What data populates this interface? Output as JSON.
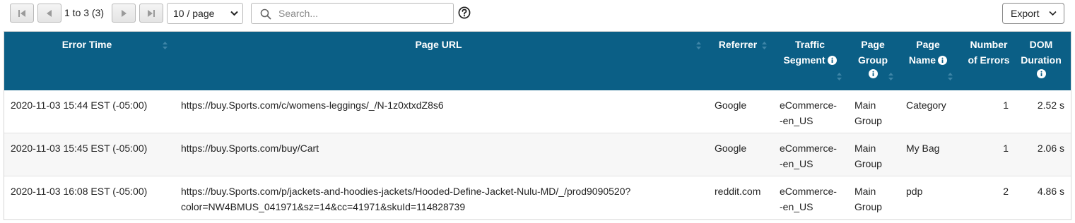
{
  "pager": {
    "range_text": "1 to 3 (3)",
    "page_size": "10 / page",
    "page_size_options": [
      "10 / page"
    ]
  },
  "search": {
    "placeholder": "Search...",
    "value": ""
  },
  "export": {
    "label": "Export"
  },
  "colors": {
    "header_bg": "#0b5f86",
    "header_text": "#ffffff",
    "row_alt": "#f7f7f7"
  },
  "columns": [
    {
      "key": "error_time",
      "label": "Error Time",
      "info": false
    },
    {
      "key": "page_url",
      "label": "Page URL",
      "info": false
    },
    {
      "key": "referrer",
      "label": "Referrer",
      "info": false
    },
    {
      "key": "traffic_segment",
      "label": "Traffic Segment",
      "info": true
    },
    {
      "key": "page_group",
      "label": "Page Group",
      "info": true
    },
    {
      "key": "page_name",
      "label": "Page Name",
      "info": true
    },
    {
      "key": "num_errors",
      "label": "Number of Errors",
      "info": false
    },
    {
      "key": "dom_duration",
      "label": "DOM Duration",
      "info": true
    }
  ],
  "rows": [
    {
      "error_time": "2020-11-03 15:44 EST (-05:00)",
      "page_url": "https://buy.Sports.com/c/womens-leggings/_/N-1z0xtxdZ8s6",
      "page_url_cont": "",
      "referrer": "Google",
      "traffic_segment_1": "eCommerce-",
      "traffic_segment_2": "-en_US",
      "page_group_1": "Main",
      "page_group_2": "Group",
      "page_name": "Category",
      "num_errors": "1",
      "dom_duration": "2.52 s"
    },
    {
      "error_time": "2020-11-03 15:45 EST (-05:00)",
      "page_url": "https://buy.Sports.com/buy/Cart",
      "page_url_cont": "",
      "referrer": "Google",
      "traffic_segment_1": "eCommerce-",
      "traffic_segment_2": "-en_US",
      "page_group_1": "Main",
      "page_group_2": "Group",
      "page_name": "My Bag",
      "num_errors": "1",
      "dom_duration": "2.06 s"
    },
    {
      "error_time": "2020-11-03 16:08 EST (-05:00)",
      "page_url": "https://buy.Sports.com/p/jackets-and-hoodies-jackets/Hooded-Define-Jacket-Nulu-MD/_/prod9090520?",
      "page_url_cont": "color=NW4BMUS_041971&sz=14&cc=41971&skuId=114828739",
      "referrer": "reddit.com",
      "traffic_segment_1": "eCommerce-",
      "traffic_segment_2": "-en_US",
      "page_group_1": "Main",
      "page_group_2": "Group",
      "page_name": "pdp",
      "num_errors": "2",
      "dom_duration": "4.86 s"
    }
  ]
}
